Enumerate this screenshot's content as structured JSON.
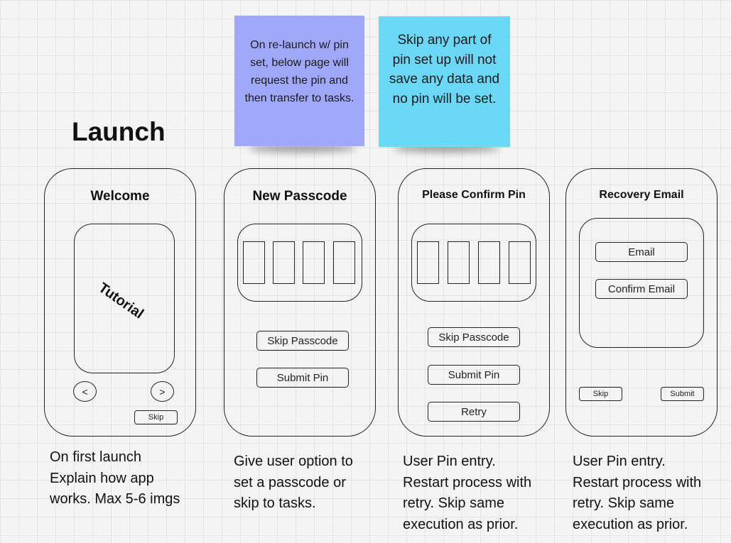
{
  "title": "Launch",
  "stickies": [
    {
      "text": "On re-launch w/ pin set, below page will request the pin and then transfer to tasks.",
      "color": "#9fa8fb"
    },
    {
      "text": "Skip any part of pin set up will not save any data and no pin will be set.",
      "color": "#6bd8f8"
    }
  ],
  "screens": {
    "welcome": {
      "title": "Welcome",
      "tutorial_label": "Tutorial",
      "prev_label": "<",
      "next_label": ">",
      "skip_label": "Skip"
    },
    "new_passcode": {
      "title": "New Passcode",
      "skip_label": "Skip Passcode",
      "submit_label": "Submit Pin"
    },
    "confirm_pin": {
      "title": "Please Confirm Pin",
      "skip_label": "Skip Passcode",
      "submit_label": "Submit Pin",
      "retry_label": "Retry"
    },
    "recovery_email": {
      "title": "Recovery Email",
      "email_label": "Email",
      "confirm_email_label": "Confirm Email",
      "skip_label": "Skip",
      "submit_label": "Submit"
    }
  },
  "descriptions": [
    "On first launch\nExplain how app\nworks. Max 5-6 imgs",
    "Give user option to\nset a passcode or\nskip to tasks.",
    "User Pin entry.\nRestart process with\nretry. Skip same\nexecution as prior.",
    "User Pin entry.\nRestart process with\nretry. Skip same\nexecution as prior."
  ]
}
